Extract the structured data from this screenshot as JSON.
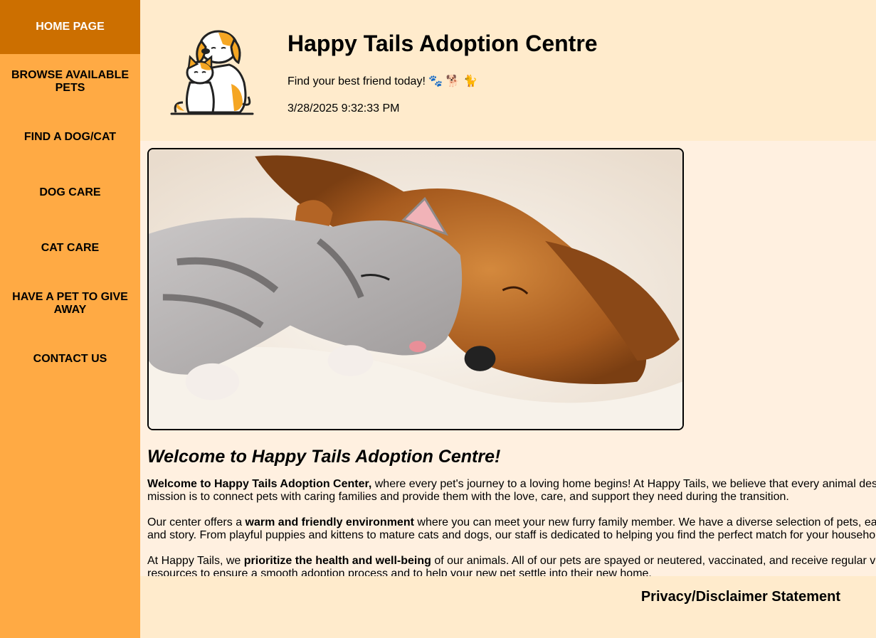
{
  "nav": {
    "items": [
      {
        "label": "HOME PAGE",
        "active": true
      },
      {
        "label": "BROWSE AVAILABLE PETS"
      },
      {
        "label": "FIND A DOG/CAT"
      },
      {
        "label": "DOG CARE"
      },
      {
        "label": "CAT CARE"
      },
      {
        "label": "HAVE A PET TO GIVE AWAY"
      },
      {
        "label": "CONTACT US"
      }
    ]
  },
  "header": {
    "title": "Happy Tails Adoption Centre",
    "tagline": "Find your best friend today! 🐾 🐕 🐈",
    "datetime": "3/28/2025 9:32:33 PM"
  },
  "main": {
    "welcome_title": "Welcome to Happy Tails Adoption Centre!",
    "p1_bold": "Welcome to Happy Tails Adoption Center,",
    "p1_rest": " where every pet's journey to a loving home begins! At Happy Tails, we believe that every animal deserves a second chance. Our mission is to connect pets with caring families and provide them with the love, care, and support they need during the transition.",
    "p2_pre": "Our center offers a ",
    "p2_bold": "warm and friendly environment",
    "p2_rest": " where you can meet your new furry family member. We have a diverse selection of pets, each with a unique personality and story. From playful puppies and kittens to mature cats and dogs, our staff is dedicated to helping you find the perfect match for your household.",
    "p3_pre": "At Happy Tails, we ",
    "p3_bold": "prioritize the health and well-being",
    "p3_rest": " of our animals. All of our pets are spayed or neutered, vaccinated, and receive regular veterinary care. We also provide resources to ensure a smooth adoption process and to help your new pet settle into their new home."
  },
  "footer": {
    "privacy": "Privacy/Disclaimer Statement"
  },
  "colors": {
    "sidebar": "#ffaa44",
    "active_nav": "#cc6f00",
    "header_bg": "#ffebcc",
    "page_bg": "#fff0e0"
  }
}
